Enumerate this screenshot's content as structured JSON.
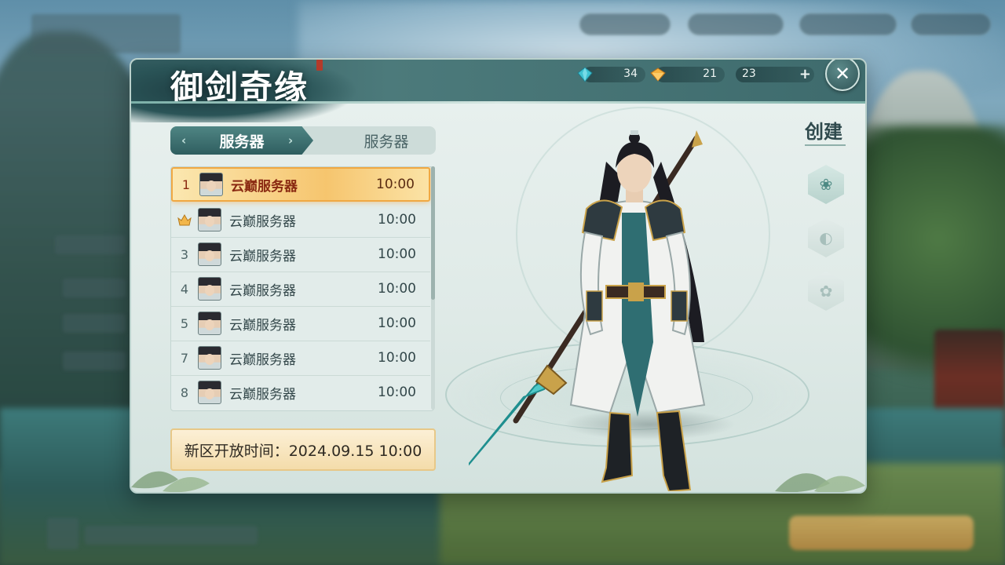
{
  "game": {
    "title": "御剑奇缘"
  },
  "currencies": [
    {
      "icon": "blue-gem-icon",
      "value": "34",
      "color": "#3fb8c9"
    },
    {
      "icon": "gold-gem-icon",
      "value": "21",
      "color": "#f0a93a"
    },
    {
      "icon": "plus-icon",
      "value": "23"
    }
  ],
  "tabs": {
    "active": "服务器",
    "inactive": "服务器"
  },
  "servers": [
    {
      "index": "1",
      "name": "云巅服务器",
      "time": "10:00",
      "selected": true
    },
    {
      "index": "",
      "icon": "crown-icon",
      "name": "云巅服务器",
      "time": "10:00"
    },
    {
      "index": "3",
      "name": "云巅服务器",
      "time": "10:00"
    },
    {
      "index": "4",
      "name": "云巅服务器",
      "time": "10:00"
    },
    {
      "index": "5",
      "name": "云巅服务器",
      "time": "10:00"
    },
    {
      "index": "7",
      "name": "云巅服务器",
      "time": "10:00"
    },
    {
      "index": "8",
      "name": "云巅服务器",
      "time": "10:00"
    }
  ],
  "open_time": "新区开放时间：2024.09.15 10:00",
  "create": {
    "label": "创建",
    "icons": [
      "lotus-icon",
      "fish-icon",
      "flower-icon"
    ]
  },
  "colors": {
    "accent": "#2f5e60",
    "highlight": "#f6c56e"
  }
}
